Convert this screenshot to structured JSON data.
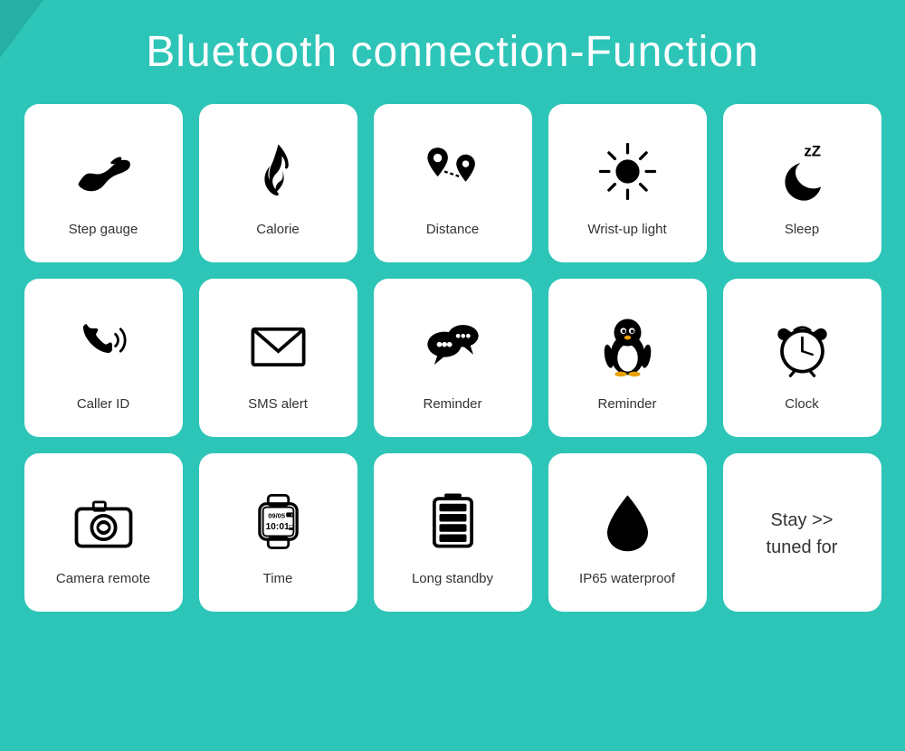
{
  "page": {
    "title": "Bluetooth connection-Function",
    "background_color": "#2dc5b8"
  },
  "features": [
    {
      "id": "step-gauge",
      "label": "Step gauge",
      "icon_type": "shoe"
    },
    {
      "id": "calorie",
      "label": "Calorie",
      "icon_type": "flame"
    },
    {
      "id": "distance",
      "label": "Distance",
      "icon_type": "map-pins"
    },
    {
      "id": "wrist-up-light",
      "label": "Wrist-up light",
      "icon_type": "sun"
    },
    {
      "id": "sleep",
      "label": "Sleep",
      "icon_type": "moon-zz"
    },
    {
      "id": "caller-id",
      "label": "Caller ID",
      "icon_type": "phone"
    },
    {
      "id": "sms-alert",
      "label": "SMS alert",
      "icon_type": "envelope"
    },
    {
      "id": "reminder-wechat",
      "label": "Reminder",
      "icon_type": "chat-bubbles"
    },
    {
      "id": "reminder-qq",
      "label": "Reminder",
      "icon_type": "penguin"
    },
    {
      "id": "clock",
      "label": "Clock",
      "icon_type": "alarm-clock"
    },
    {
      "id": "camera-remote",
      "label": "Camera remote",
      "icon_type": "camera"
    },
    {
      "id": "time",
      "label": "Time",
      "icon_type": "watch-display"
    },
    {
      "id": "long-standby",
      "label": "Long standby",
      "icon_type": "battery"
    },
    {
      "id": "ip65-waterproof",
      "label": "IP65  waterproof",
      "icon_type": "water-drop"
    },
    {
      "id": "stay-tuned",
      "label": "Stay >>\ntuned for",
      "icon_type": "text-only"
    }
  ]
}
